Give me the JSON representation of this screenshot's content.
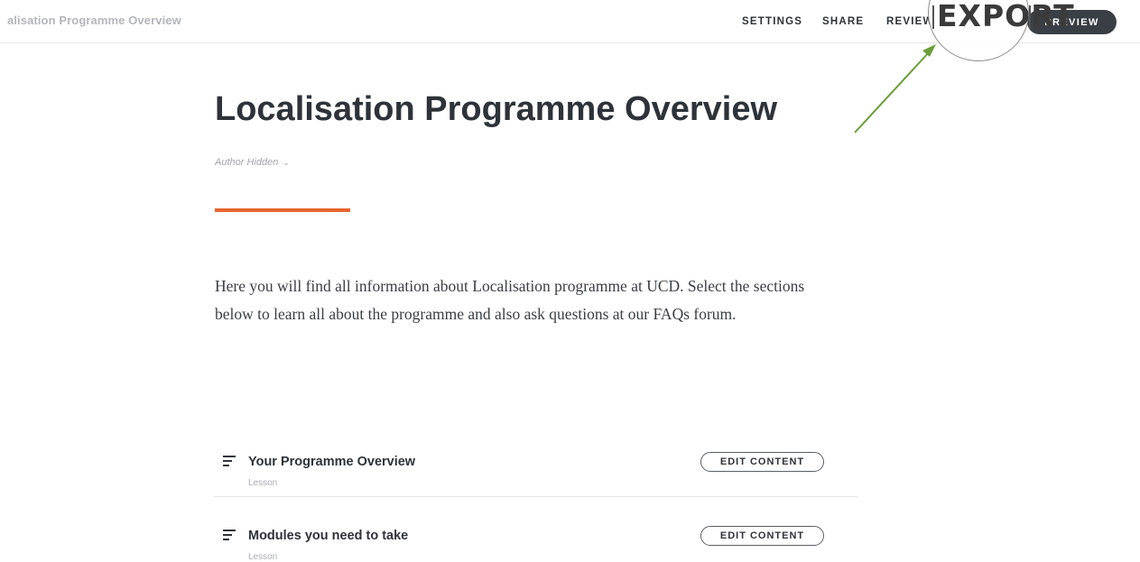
{
  "header": {
    "title": "alisation Programme Overview",
    "nav": {
      "settings": "SETTINGS",
      "share": "SHARE",
      "review": "REVIEW",
      "export": "EXPORT",
      "preview": "PREVIEW"
    }
  },
  "main": {
    "title": "Localisation Programme Overview",
    "author": "Author Hidden",
    "accent_color": "#e7642f",
    "description": "Here you will find all information about Localisation programme at UCD. Select the sections below to learn all about the programme and also ask questions at our FAQs forum."
  },
  "lessons": [
    {
      "title": "Your Programme Overview",
      "type": "Lesson",
      "button": "EDIT CONTENT",
      "icon": "lesson-lines-icon"
    },
    {
      "title": "Modules you need to take",
      "type": "Lesson",
      "button": "EDIT CONTENT",
      "icon": "lesson-lines-icon"
    }
  ],
  "annotation": {
    "arrow_color": "#6a9e3a"
  }
}
